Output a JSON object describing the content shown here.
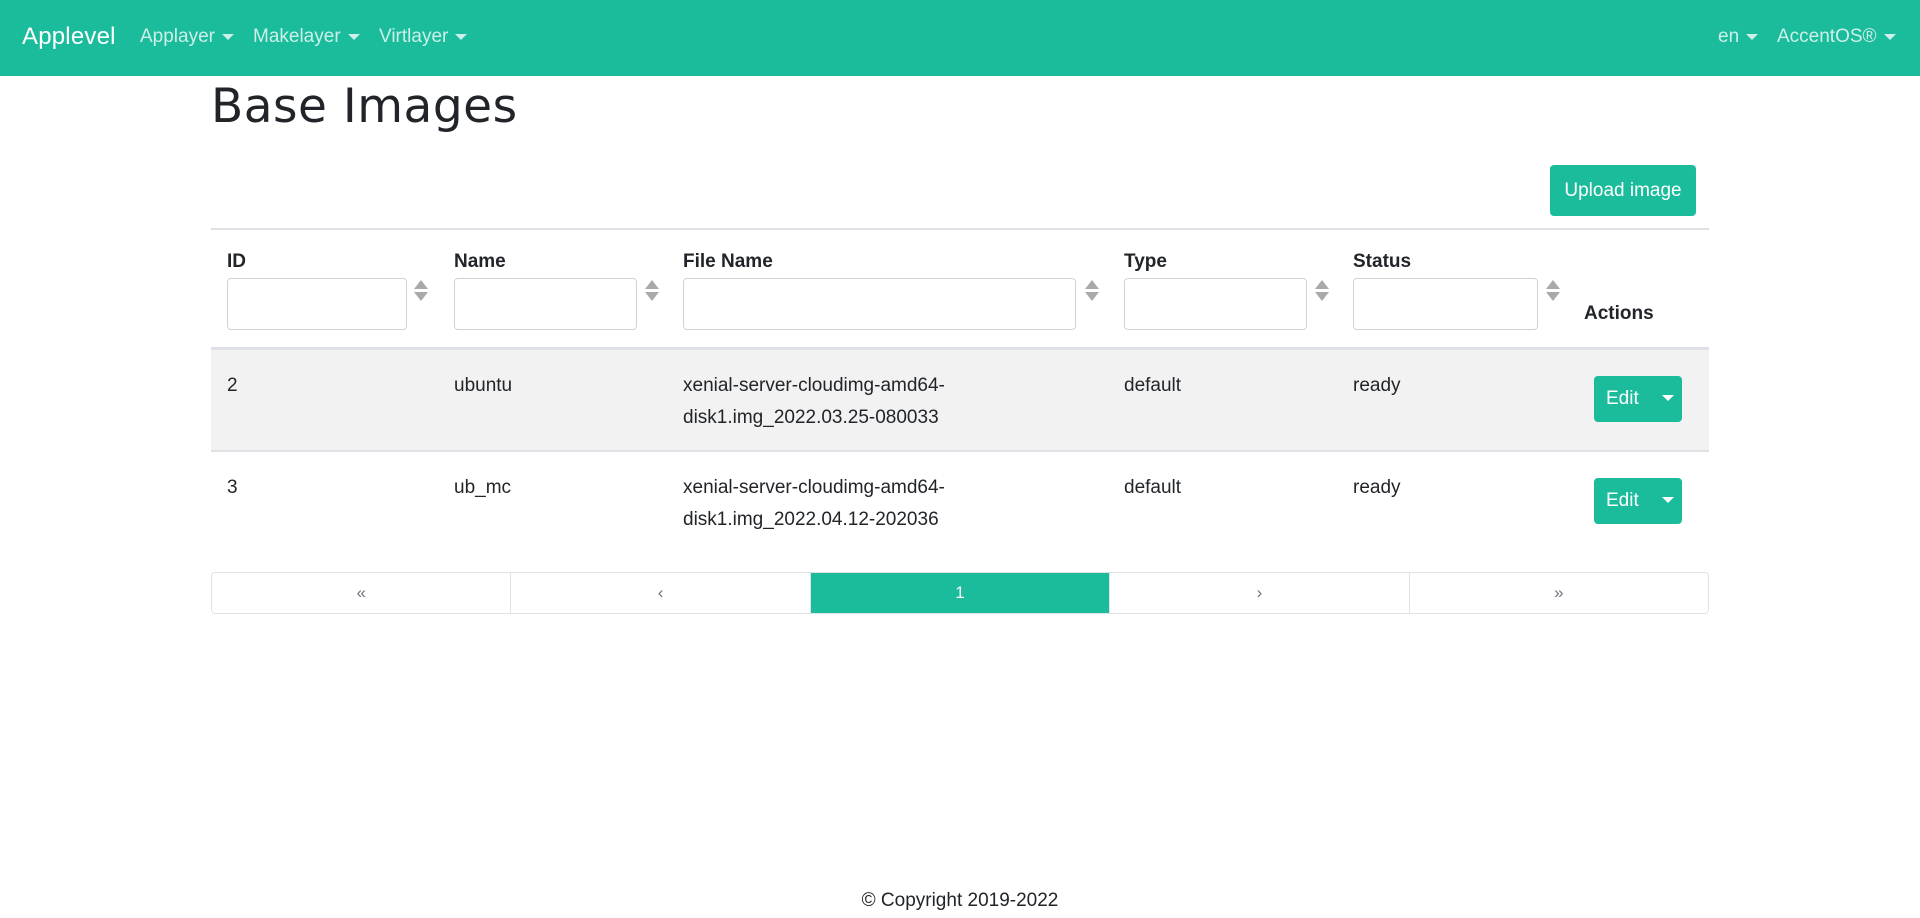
{
  "navbar": {
    "brand": "Applevel",
    "items": [
      {
        "label": "Applayer"
      },
      {
        "label": "Makelayer"
      },
      {
        "label": "Virtlayer"
      }
    ],
    "language": "en",
    "account": "AccentOS®"
  },
  "page": {
    "title": "Base Images",
    "upload_label": "Upload image"
  },
  "table": {
    "columns": [
      {
        "label": "ID"
      },
      {
        "label": "Name"
      },
      {
        "label": "File Name"
      },
      {
        "label": "Type"
      },
      {
        "label": "Status"
      },
      {
        "label": "Actions"
      }
    ],
    "filters": {
      "id": "",
      "name": "",
      "file_name": "",
      "type": "",
      "status": ""
    },
    "rows": [
      {
        "id": "2",
        "name": "ubuntu",
        "file_name_line1": "xenial-server-cloudimg-amd64-",
        "file_name_line2": "disk1.img_2022.03.25-080033",
        "type": "default",
        "status": "ready",
        "action": "Edit"
      },
      {
        "id": "3",
        "name": "ub_mc",
        "file_name_line1": "xenial-server-cloudimg-amd64-",
        "file_name_line2": "disk1.img_2022.04.12-202036",
        "type": "default",
        "status": "ready",
        "action": "Edit"
      }
    ]
  },
  "pagination": {
    "first": "«",
    "prev": "‹",
    "current": "1",
    "next": "›",
    "last": "»"
  },
  "footer": {
    "copyright": "© Copyright 2019-2022"
  },
  "colors": {
    "accent": "#1abc9c",
    "stripe": "#f2f2f2"
  }
}
